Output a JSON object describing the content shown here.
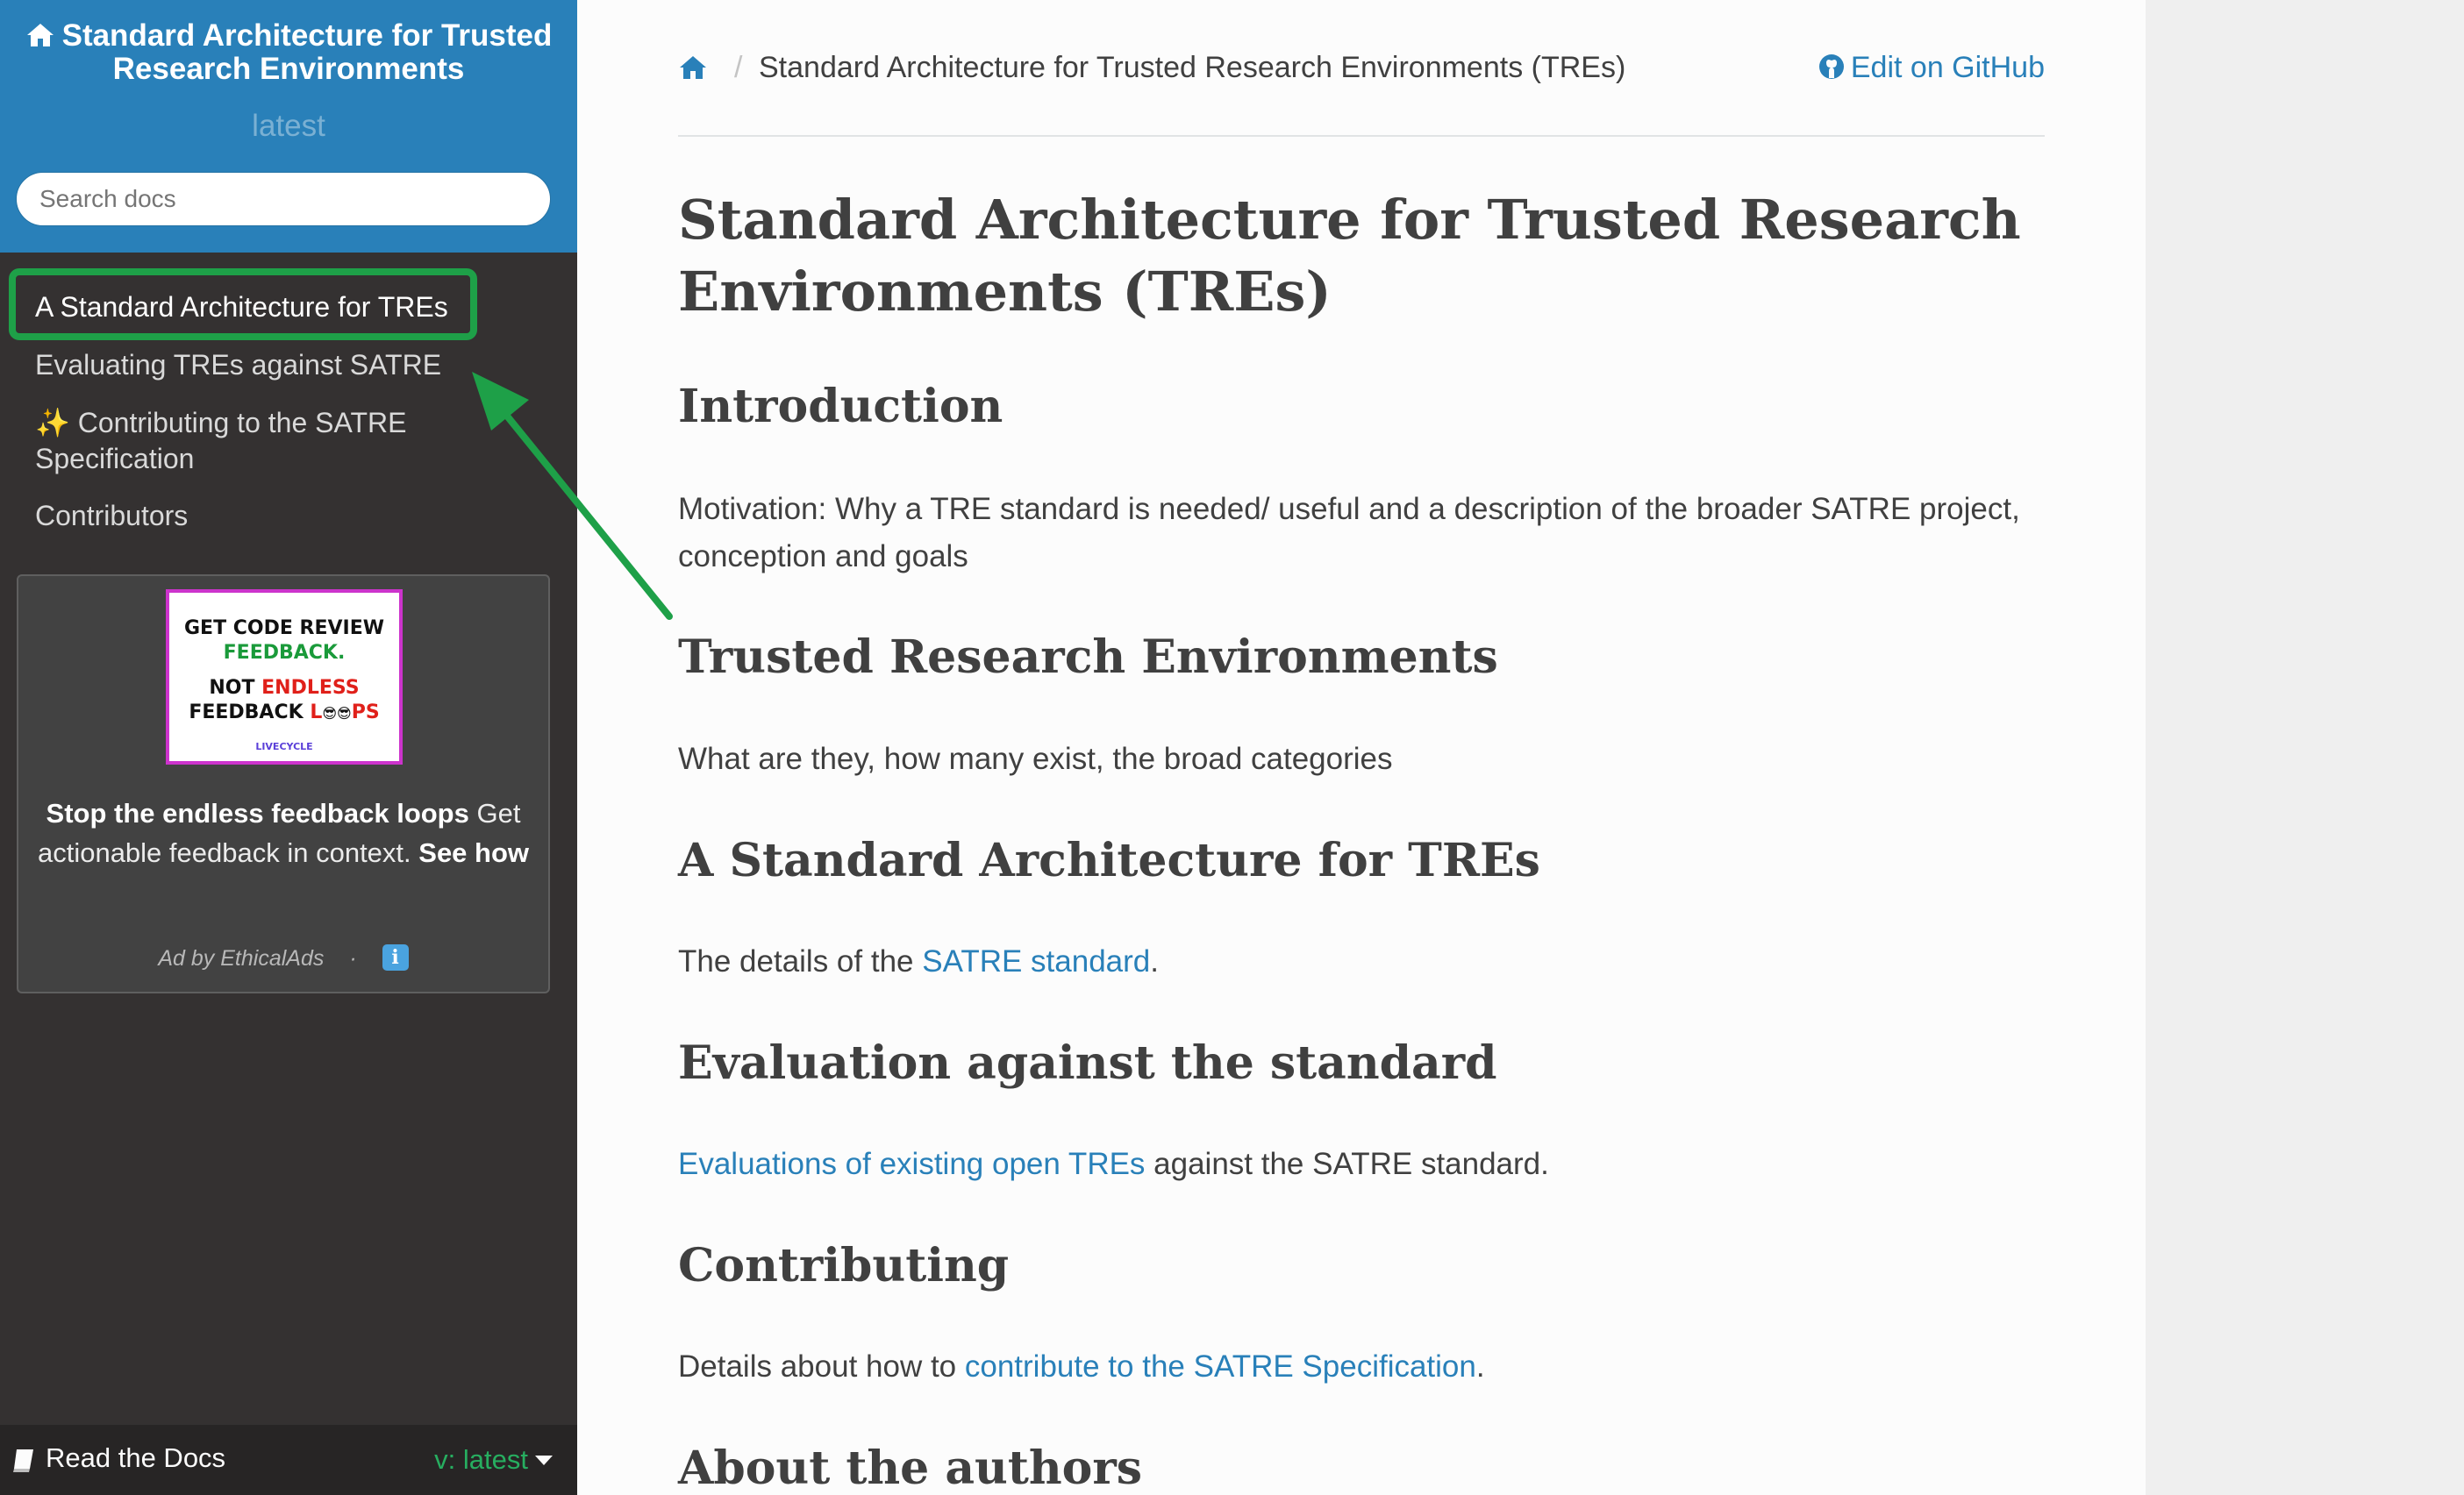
{
  "sidebar": {
    "project_title": "Standard Architecture for Trusted Research Environments",
    "version": "latest",
    "search_placeholder": "Search docs",
    "items": [
      {
        "label": "A Standard Architecture for TREs",
        "current": true
      },
      {
        "label": "Evaluating TREs against SATRE"
      },
      {
        "label": "✨ Contributing to the SATRE"
      },
      {
        "label": "Specification"
      },
      {
        "label": "Contributors"
      }
    ],
    "ad": {
      "image_line1": "GET CODE REVIEW",
      "image_line2": "FEEDBACK.",
      "image_line3_a": "NOT ",
      "image_line3_b": "ENDLESS",
      "image_line4_a": "FEEDBACK ",
      "image_line4_b": "L",
      "image_line4_c": "😎😎",
      "image_line4_d": "PS",
      "brand": "LIVECYCLE",
      "text_bold": "Stop the endless feedback loops",
      "text_mid": " Get actionable feedback in context. ",
      "text_link": "See how",
      "by": "Ad by EthicalAds",
      "dot": "·",
      "info": "i"
    },
    "footer": {
      "rtd_label": "Read the Docs",
      "version_label": "v: latest"
    }
  },
  "breadcrumb": {
    "page": "Standard Architecture for Trusted Research Environments (TREs)",
    "separator": "/",
    "edit_label": "Edit on GitHub"
  },
  "article": {
    "title": "Standard Architecture for Trusted Research Environments (TREs)",
    "intro_heading": "Introduction",
    "intro_text": "Motivation: Why a TRE standard is needed/ useful and a description of the broader SATRE project, conception and goals",
    "tre_heading": "Trusted Research Environments",
    "tre_text": "What are they, how many exist, the broad categories",
    "std_heading": "A Standard Architecture for TREs",
    "std_text_before": "The details of the ",
    "std_link": "SATRE standard",
    "std_text_after": ".",
    "eval_heading": "Evaluation against the standard",
    "eval_link": "Evaluations of existing open TREs",
    "eval_text_after": " against the SATRE standard.",
    "contrib_heading": "Contributing",
    "contrib_text_before": "Details about how to ",
    "contrib_link": "contribute to the SATRE Specification",
    "contrib_text_after": ".",
    "authors_heading": "About the authors"
  },
  "colors": {
    "sidebar_bg": "#343131",
    "header_bg": "#2980b9",
    "link": "#2980b9",
    "highlight": "#1ea048",
    "version_green": "#27ae60"
  }
}
